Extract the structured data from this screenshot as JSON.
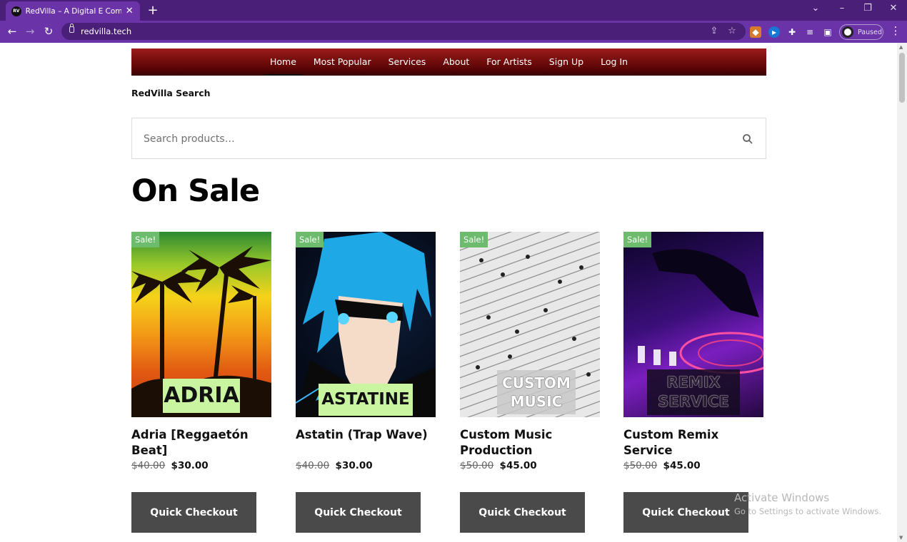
{
  "browser": {
    "tab_title": "RedVilla – A Digital E Commerce",
    "favicon_text": "RV",
    "new_tab": "+",
    "url": "redvilla.tech",
    "profile_status": "Paused"
  },
  "site_nav": {
    "items": [
      "Home",
      "Most Popular",
      "Services",
      "About",
      "For Artists",
      "Sign Up",
      "Log In"
    ],
    "active": "Home"
  },
  "search": {
    "heading": "RedVilla Search",
    "placeholder": "Search products…"
  },
  "section_title": "On Sale",
  "products": [
    {
      "badge": "Sale!",
      "art_text": "ADRIA",
      "name": "Adria [Reggaetón Beat]",
      "old_price": "$40.00",
      "new_price": "$30.00",
      "button": "Quick Checkout"
    },
    {
      "badge": "Sale!",
      "art_text": "ASTATINE",
      "name": "Astatin (Trap Wave)",
      "old_price": "$40.00",
      "new_price": "$30.00",
      "button": "Quick Checkout"
    },
    {
      "badge": "Sale!",
      "art_text_1": "CUSTOM",
      "art_text_2": "MUSIC",
      "name": "Custom Music Production",
      "old_price": "$50.00",
      "new_price": "$45.00",
      "button": "Quick Checkout"
    },
    {
      "badge": "Sale!",
      "art_text_1": "REMIX",
      "art_text_2": "SERVICE",
      "name": "Custom Remix Service",
      "old_price": "$50.00",
      "new_price": "$45.00",
      "button": "Quick Checkout"
    }
  ],
  "watermark": {
    "title": "Activate Windows",
    "subtitle": "Go to Settings to activate Windows."
  }
}
